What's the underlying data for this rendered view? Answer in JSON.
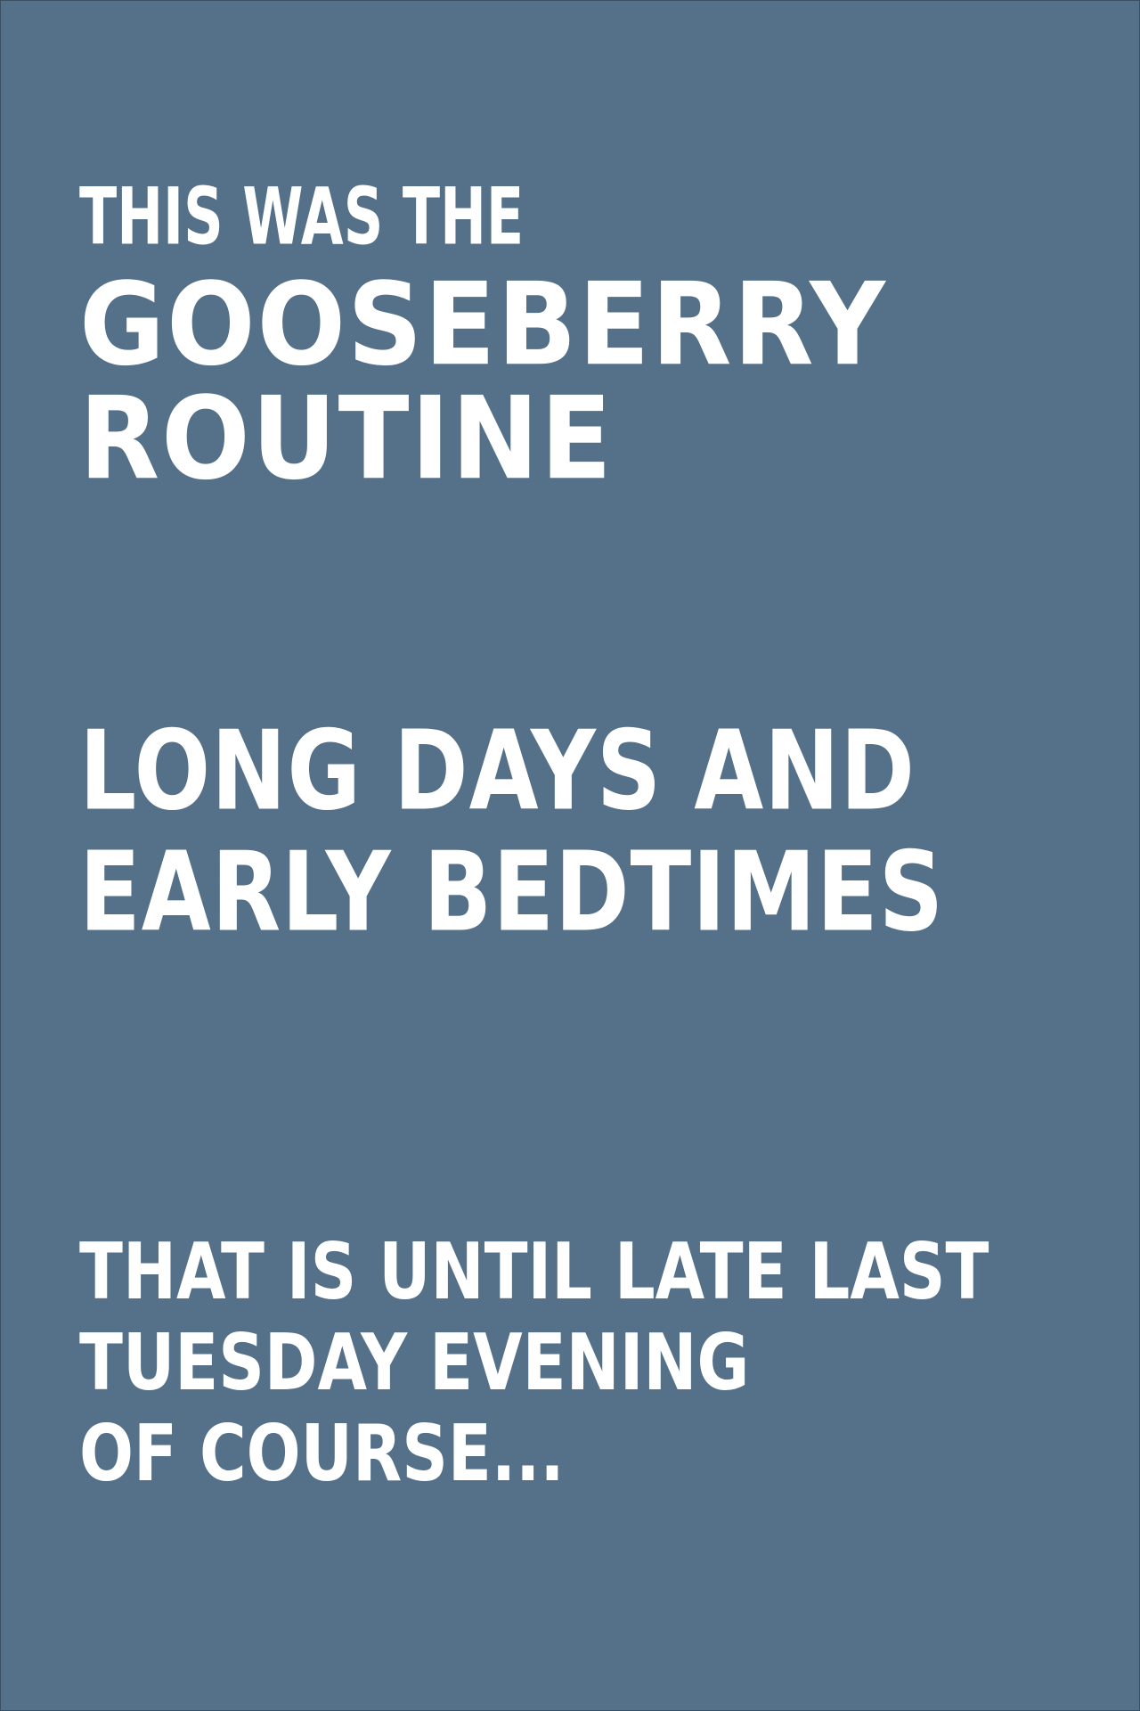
{
  "panel": {
    "background_color": "#557089",
    "text_color": "#ffffff",
    "block1": {
      "intro": "THIS WAS THE",
      "title_line1": "GOOSEBERRY",
      "title_line2": "ROUTINE"
    },
    "block2": {
      "line1": "LONG DAYS AND",
      "line2": "EARLY BEDTIMES"
    },
    "block3": {
      "line1": "THAT IS UNTIL LATE LAST",
      "line2": "TUESDAY EVENING",
      "line3": "OF COURSE..."
    }
  }
}
